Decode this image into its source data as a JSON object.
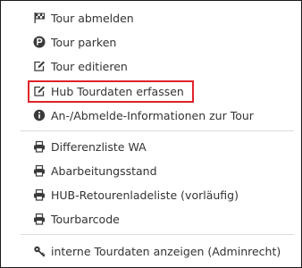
{
  "menu": {
    "items": [
      {
        "label": "Tour abmelden",
        "icon": "flag-checkered-icon"
      },
      {
        "label": "Tour parken",
        "icon": "parking-icon"
      },
      {
        "label": "Tour editieren",
        "icon": "edit-icon"
      },
      {
        "label": "Hub Tourdaten erfassen",
        "icon": "edit-icon",
        "highlighted": true
      },
      {
        "label": "An-/Abmelde-Informationen zur Tour",
        "icon": "info-circle-icon"
      },
      {
        "label": "Differenzliste WA",
        "icon": "print-icon"
      },
      {
        "label": "Abarbeitungsstand",
        "icon": "print-icon"
      },
      {
        "label": "HUB-Retourenladeliste (vorläufig)",
        "icon": "print-icon"
      },
      {
        "label": "Tourbarcode",
        "icon": "print-icon"
      },
      {
        "label": "interne Tourdaten anzeigen (Adminrecht)",
        "icon": "key-icon"
      }
    ]
  },
  "colors": {
    "highlight_border": "#e0232a",
    "text": "#333333",
    "icon": "#3a3a3a",
    "divider": "#dcdcdc"
  }
}
